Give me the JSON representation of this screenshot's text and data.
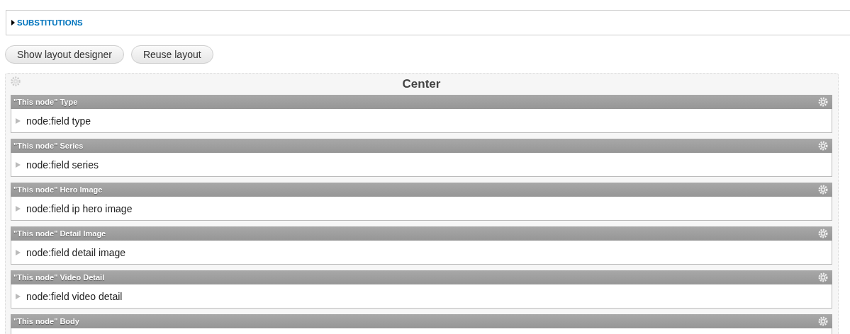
{
  "fieldset": {
    "legend": "SUBSTITUTIONS",
    "expanded": false
  },
  "buttons": [
    "Show layout designer",
    "Reuse layout"
  ],
  "region": {
    "title": "Center",
    "panes": [
      {
        "title": "\"This node\" Type",
        "content": "node:field type"
      },
      {
        "title": "\"This node\" Series",
        "content": "node:field series"
      },
      {
        "title": "\"This node\" Hero Image",
        "content": "node:field ip hero image"
      },
      {
        "title": "\"This node\" Detail Image",
        "content": "node:field detail image"
      },
      {
        "title": "\"This node\" Video Detail",
        "content": "node:field video detail"
      },
      {
        "title": "\"This node\" Body"
      }
    ]
  }
}
